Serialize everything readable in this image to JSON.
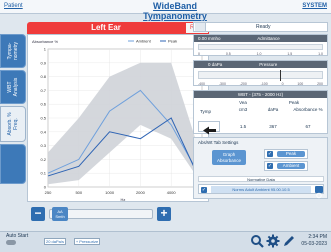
{
  "header": {
    "patient_link": "Patient",
    "title": "WideBand Tympanometry",
    "system_link": "SYSTEM"
  },
  "left_tabs": [
    {
      "label": "Tympa-\nnometry",
      "active": false
    },
    {
      "label": "WBT\nAnalysis",
      "active": false
    },
    {
      "label": "Absorb. %\nFreq.",
      "active": true
    },
    {
      "label": "",
      "active": false
    }
  ],
  "chart_header": {
    "ear_label": "Left Ear",
    "right_button": "Right"
  },
  "chart_data": {
    "type": "line",
    "ylabel": "Absorbance %",
    "xlabel": "Hz",
    "legend": [
      "Ambient",
      "Peak"
    ],
    "x": [
      250,
      500,
      1000,
      2000,
      4000,
      8000
    ],
    "x_ticks": [
      250,
      500,
      1000,
      2000,
      4000,
      8000
    ],
    "y_ticks": [
      1.0,
      0.9,
      0.8,
      0.7,
      0.6,
      0.5,
      0.4,
      0.3,
      0.2,
      0.1,
      0
    ],
    "ylim": [
      0,
      1
    ],
    "series": [
      {
        "name": "Ambient",
        "values": [
          0.1,
          0.2,
          0.55,
          0.7,
          0.45,
          0.05
        ]
      },
      {
        "name": "Peak",
        "values": [
          0.08,
          0.15,
          0.4,
          0.35,
          0.5,
          0.02
        ]
      }
    ],
    "norm_upper": [
      0.25,
      0.5,
      0.8,
      0.9,
      0.9,
      0.2
    ],
    "norm_lower": [
      0.02,
      0.05,
      0.25,
      0.45,
      0.35,
      0.02
    ]
  },
  "zoom": {
    "minus": "−",
    "plus": "+",
    "thumb_label": "AA\nSmth"
  },
  "status": {
    "text": "Ready"
  },
  "admittance": {
    "value_label": "0.00 mmho",
    "header": "Admittance",
    "ticks": [
      "0",
      "0.5",
      "1.0",
      "1.5",
      "1.0"
    ]
  },
  "pressure": {
    "value_label": "0 daPa",
    "header": "Pressure",
    "ticks": [
      "-400",
      "-300",
      "-200",
      "-100",
      "0",
      "100",
      "200"
    ]
  },
  "wbt": {
    "title": "WBT - (375 - 2000 Hz)",
    "row_label": "Tymp",
    "col_headers": [
      "Vea",
      "Peak"
    ],
    "sub_headers": [
      "cm3",
      "daPa",
      "Absorbance %"
    ],
    "values": [
      "1.5",
      "367",
      "67"
    ]
  },
  "settings": {
    "title": "Abs/Wt Tab Settings",
    "btn_graph": "Graph\nAbsorbance",
    "chk_peak": "Peak",
    "chk_ambient": "Ambient",
    "normative_label": "Normative Data",
    "normative_value": "Norms Adult Ambient 95.00.10.5"
  },
  "bottom": {
    "auto_start": "Auto Start",
    "btn1": "20 daPa/s",
    "btn2": "+ Pressurize",
    "time": "2:34 PM",
    "date": "05-03-2023"
  }
}
